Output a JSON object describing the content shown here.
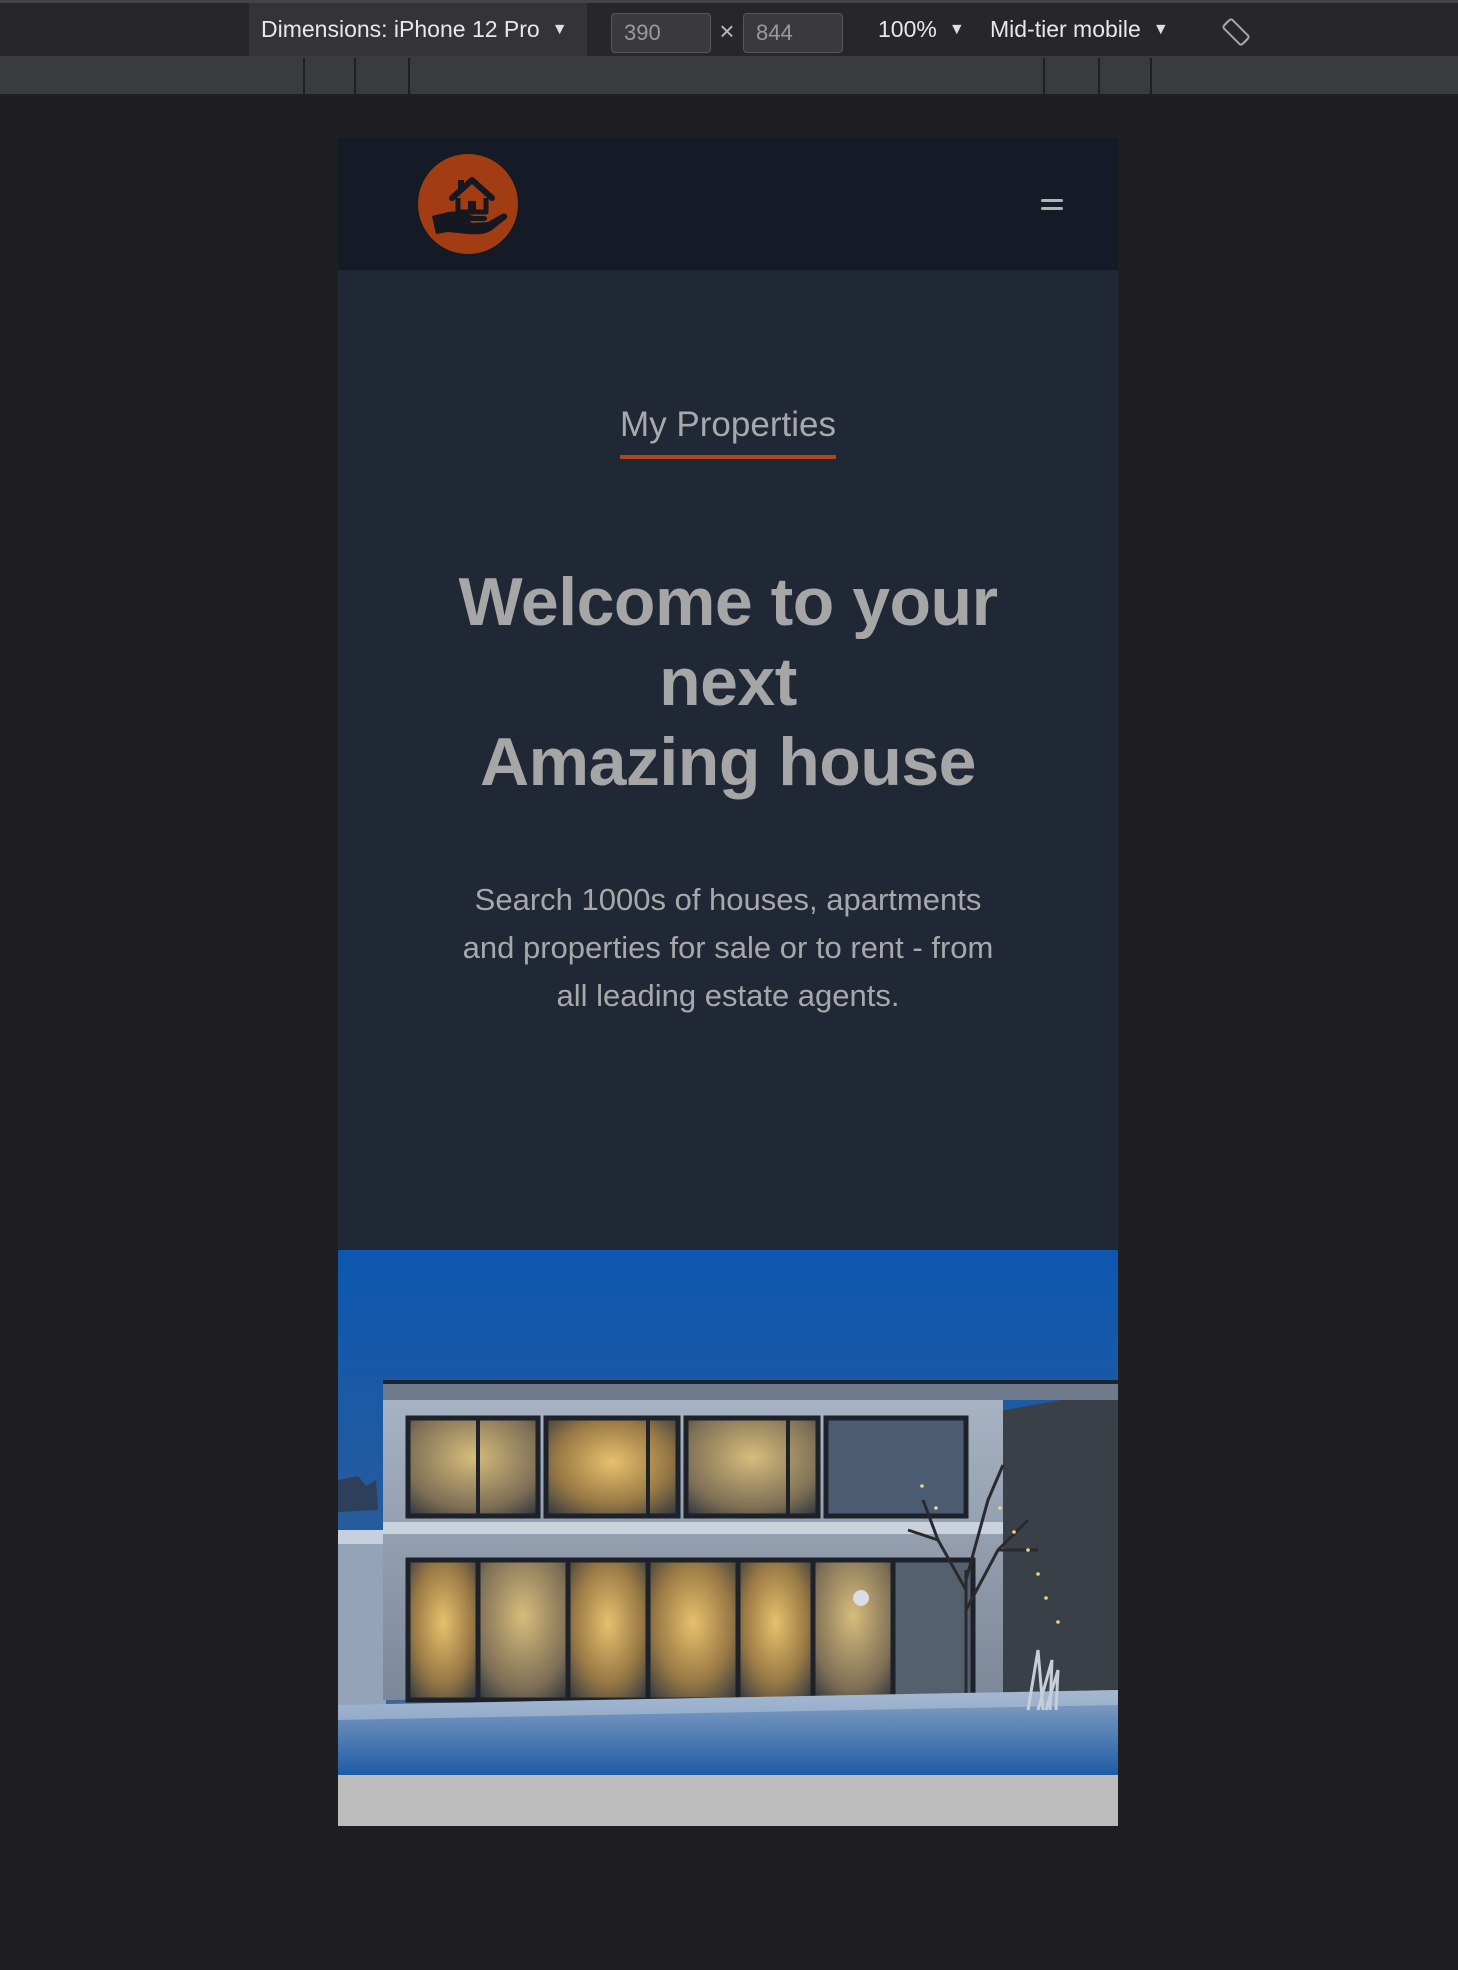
{
  "devtools": {
    "dimensions_label": "Dimensions: iPhone 12 Pro",
    "width_value": "390",
    "height_value": "844",
    "times_symbol": "×",
    "zoom_label": "100%",
    "throttle_label": "Mid-tier mobile",
    "caret_symbol": "▼",
    "rotate_icon": "rotate-device-icon"
  },
  "site": {
    "logo_icon": "house-in-hand-icon",
    "menu_icon": "hamburger-menu-icon",
    "brand_title": "My Properties",
    "headline_lines": [
      "Welcome to your",
      "next",
      "Amazing house"
    ],
    "subtext": "Search 1000s of houses, apartments and properties for sale or to rent - from all leading estate agents.",
    "hero_image": "modern-house-at-dusk-photo"
  },
  "colors": {
    "page_background": "#1f1f21",
    "header_background": "#141b27",
    "hero_background": "#202735",
    "accent": "#b6461a",
    "logo_circle": "#a13c13",
    "text_muted": "#a8a8a8"
  }
}
